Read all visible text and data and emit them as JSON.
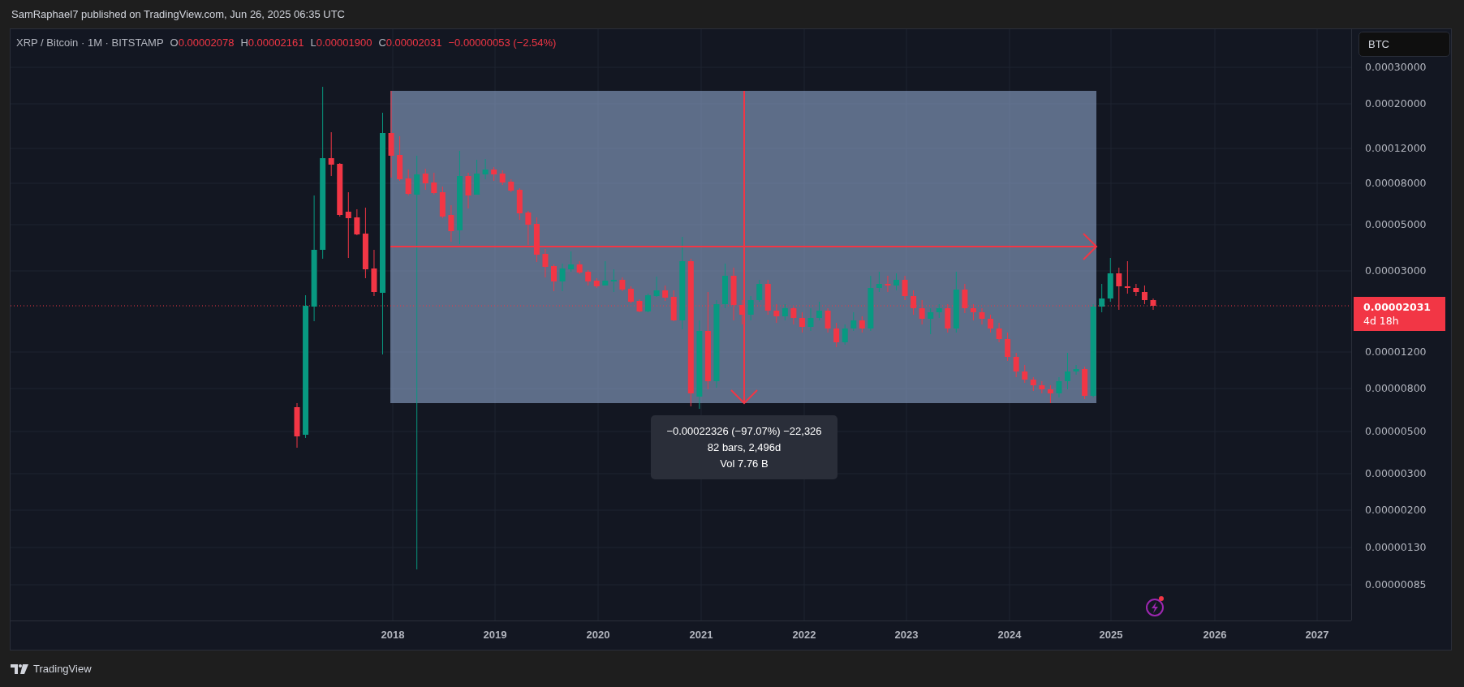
{
  "header": {
    "text": "SamRaphael7 published on TradingView.com, Jun 26, 2025 06:35 UTC"
  },
  "legend": {
    "symbol": "XRP / Bitcoin · 1M · BITSTAMP",
    "fields": [
      {
        "label": "O",
        "value": "0.00002078"
      },
      {
        "label": "H",
        "value": "0.00002161"
      },
      {
        "label": "L",
        "value": "0.00001900"
      },
      {
        "label": "C",
        "value": "0.00002031"
      }
    ],
    "change": "−0.00000053 (−2.54%)"
  },
  "currency_button": "BTC",
  "price_axis": {
    "ticks": [
      "0.00030000",
      "0.00020000",
      "0.00012000",
      "0.00008000",
      "0.00005000",
      "0.00003000",
      "0.00001200",
      "0.00000800",
      "0.00000500",
      "0.00000300",
      "0.00000200",
      "0.00000130",
      "0.00000085"
    ],
    "last_price": "0.00002031",
    "countdown": "4d 18h"
  },
  "time_axis": {
    "labels": [
      "2018",
      "2019",
      "2020",
      "2021",
      "2022",
      "2023",
      "2024",
      "2025",
      "2026",
      "2027"
    ]
  },
  "measure_tooltip": {
    "lines": [
      "−0.00022326 (−97.07%) −22,326",
      "82 bars, 2,496d",
      "Vol 7.76 B"
    ]
  },
  "footer": {
    "brand": "TradingView"
  }
}
